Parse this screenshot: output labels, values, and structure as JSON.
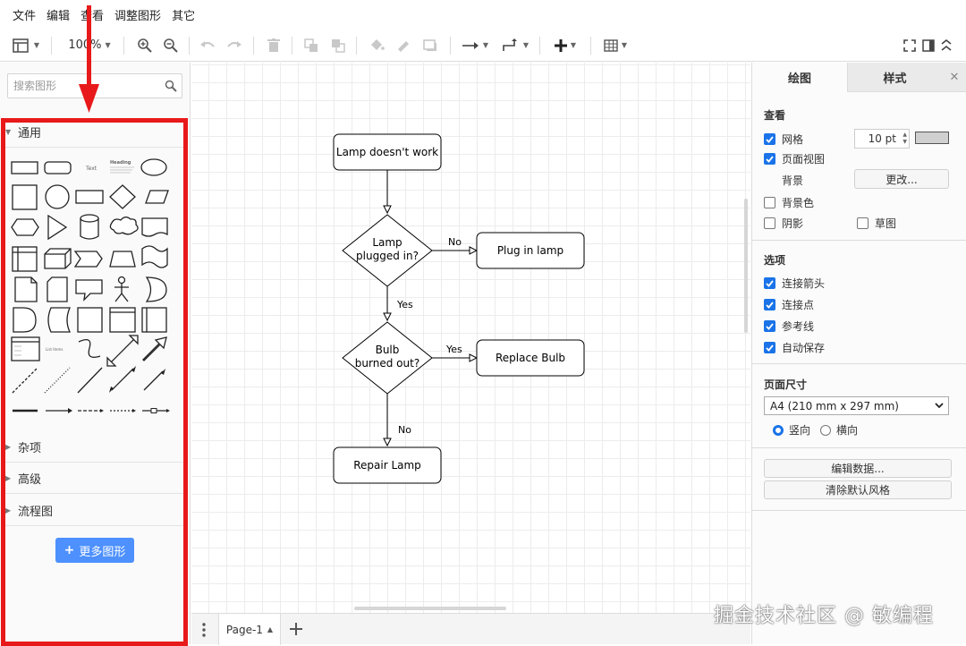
{
  "menu": [
    "文件",
    "编辑",
    "查看",
    "调整图形",
    "其它"
  ],
  "toolbar": {
    "zoom": "100%"
  },
  "left": {
    "search_placeholder": "搜索图形",
    "sections": [
      {
        "label": "通用",
        "expanded": true
      },
      {
        "label": "杂项",
        "expanded": false
      },
      {
        "label": "高级",
        "expanded": false
      },
      {
        "label": "流程图",
        "expanded": false
      }
    ],
    "shape_tiles": {
      "text": "Text",
      "heading": "Heading",
      "list": "List Items"
    },
    "more_shapes": "更多图形",
    "more_plus": "+"
  },
  "diagram": {
    "nodes": {
      "start": "Lamp doesn't work",
      "plugged_line1": "Lamp",
      "plugged_line2": "plugged in?",
      "plug": "Plug in lamp",
      "bulb_line1": "Bulb",
      "bulb_line2": "burned out?",
      "replace": "Replace Bulb",
      "repair": "Repair Lamp"
    },
    "edges": {
      "plugged_no": "No",
      "plugged_yes": "Yes",
      "bulb_yes": "Yes",
      "bulb_no": "No"
    }
  },
  "pages": {
    "tab": "Page-1"
  },
  "right": {
    "tabs": [
      "绘图",
      "样式"
    ],
    "close": "✕",
    "view_heading": "查看",
    "grid_label": "网格",
    "grid_checked": true,
    "grid_size": "10 pt",
    "pageview_label": "页面视图",
    "pageview_checked": true,
    "background_label": "背景",
    "change_button": "更改...",
    "bgcolor_label": "背景色",
    "bgcolor_checked": false,
    "shadow_label": "阴影",
    "shadow_checked": false,
    "sketch_label": "草图",
    "sketch_checked": false,
    "options_heading": "选项",
    "options": [
      {
        "label": "连接箭头",
        "checked": true
      },
      {
        "label": "连接点",
        "checked": true
      },
      {
        "label": "参考线",
        "checked": true
      },
      {
        "label": "自动保存",
        "checked": true
      }
    ],
    "pagesize_heading": "页面尺寸",
    "pagesize_value": "A4 (210 mm x 297 mm)",
    "portrait_label": "竖向",
    "landscape_label": "横向",
    "orientation": "portrait",
    "edit_data_button": "编辑数据...",
    "clear_style_button": "清除默认风格"
  },
  "watermark": "掘金技术社区 @ 敏编程",
  "colors": {
    "accent": "#1a73e8",
    "highlight": "#e8191a",
    "primary_button": "#4d90fe"
  }
}
